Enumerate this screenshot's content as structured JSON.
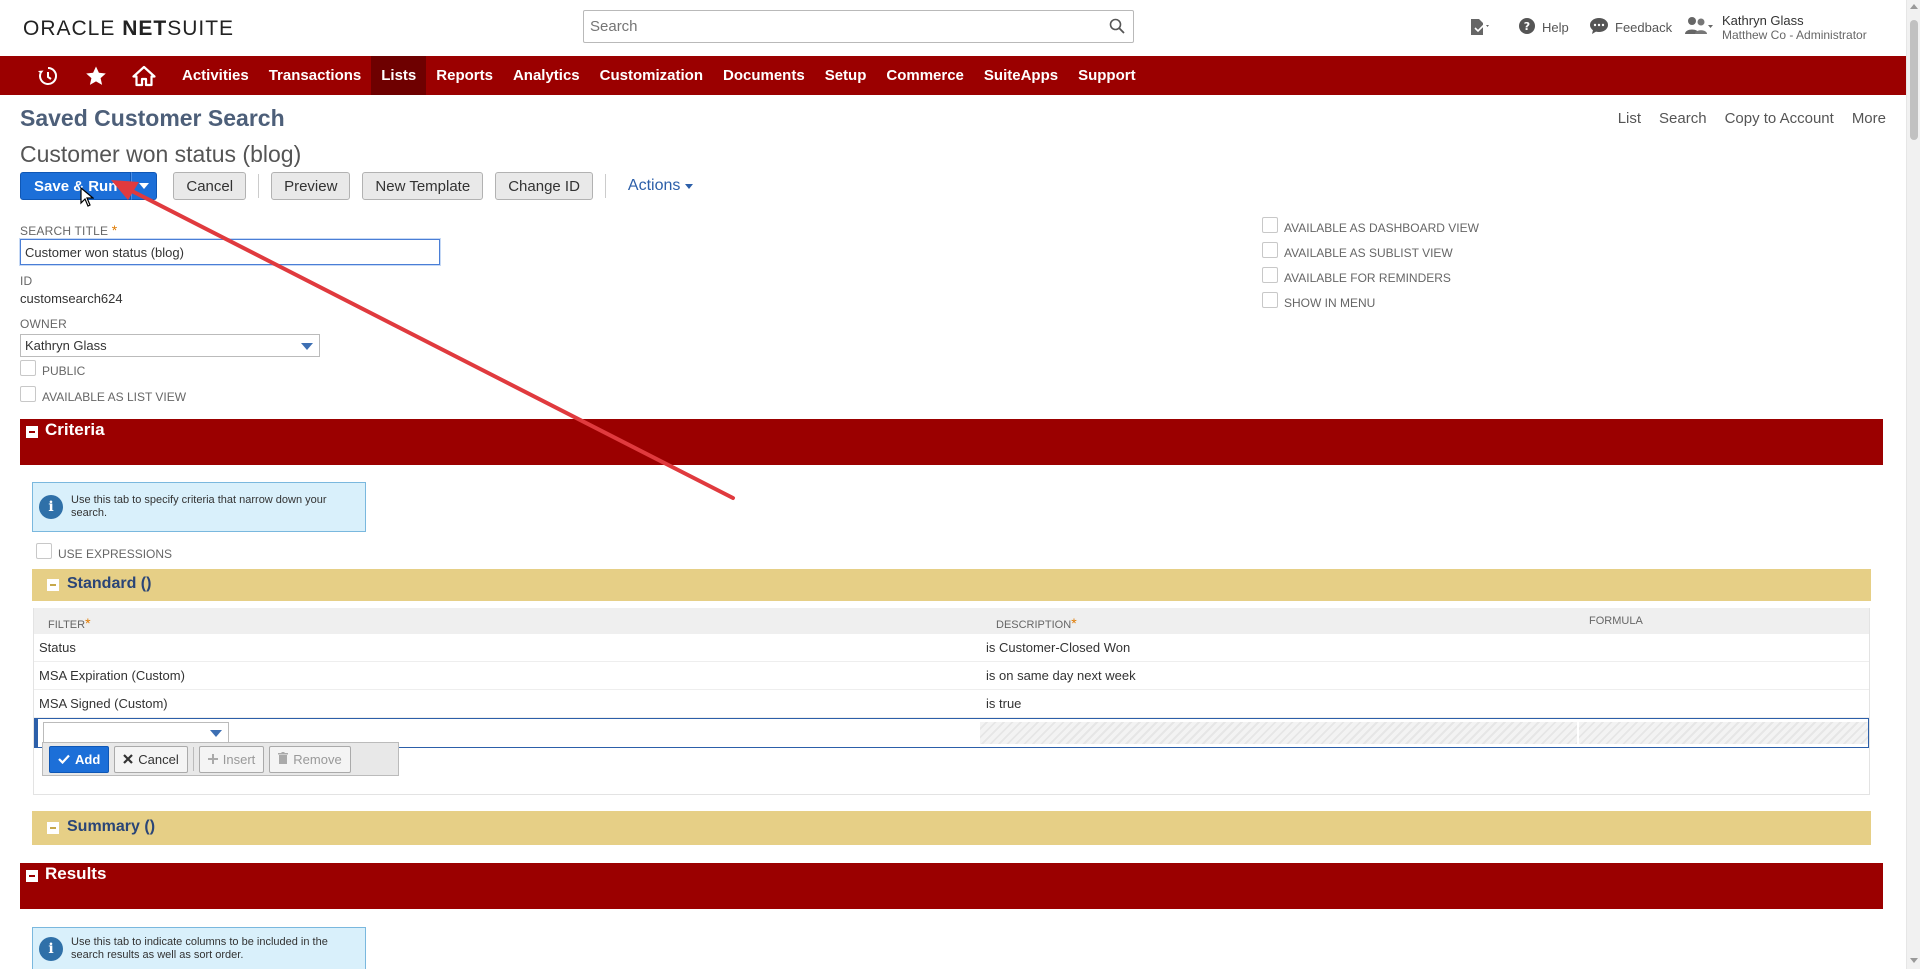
{
  "header": {
    "logo_brand": "ORACLE",
    "logo_product_bold": "NET",
    "logo_product": "SUITE",
    "search_placeholder": "Search",
    "help_label": "Help",
    "feedback_label": "Feedback",
    "user_name": "Kathryn Glass",
    "user_role": "Matthew Co - Administrator"
  },
  "nav": {
    "items": [
      "Activities",
      "Transactions",
      "Lists",
      "Reports",
      "Analytics",
      "Customization",
      "Documents",
      "Setup",
      "Commerce",
      "SuiteApps",
      "Support"
    ],
    "active": "Lists"
  },
  "page": {
    "header": "Saved Customer Search",
    "links": [
      "List",
      "Search",
      "Copy to Account",
      "More"
    ],
    "record_title": "Customer won status (blog)"
  },
  "toolbar": {
    "save_run": "Save & Run",
    "cancel": "Cancel",
    "preview": "Preview",
    "new_template": "New Template",
    "change_id": "Change ID",
    "actions": "Actions"
  },
  "form": {
    "search_title_label": "SEARCH TITLE",
    "search_title_value": "Customer won status (blog)",
    "id_label": "ID",
    "id_value": "customsearch624",
    "owner_label": "OWNER",
    "owner_value": "Kathryn Glass",
    "public_label": "PUBLIC",
    "list_view_label": "AVAILABLE AS LIST VIEW",
    "dashboard_label": "AVAILABLE AS DASHBOARD VIEW",
    "sublist_label": "AVAILABLE AS SUBLIST VIEW",
    "reminders_label": "AVAILABLE FOR REMINDERS",
    "menu_label": "SHOW IN MENU"
  },
  "criteria": {
    "title": "Criteria",
    "info": "Use this tab to specify criteria that narrow down your search.",
    "use_expressions": "USE EXPRESSIONS",
    "standard_title": "Standard ()",
    "columns": {
      "filter": "FILTER",
      "description": "DESCRIPTION",
      "formula": "FORMULA"
    },
    "rows": [
      {
        "filter": "Status",
        "description": "is Customer-Closed Won"
      },
      {
        "filter": "MSA Expiration (Custom)",
        "description": "is on same day next week"
      },
      {
        "filter": "MSA Signed (Custom)",
        "description": "is true"
      }
    ],
    "buttons": {
      "add": "Add",
      "cancel": "Cancel",
      "insert": "Insert",
      "remove": "Remove"
    },
    "summary_title": "Summary ()"
  },
  "results": {
    "title": "Results",
    "info": "Use this tab to indicate columns to be included in the search results as well as sort order."
  },
  "colors": {
    "brand_red": "#9b0000",
    "primary_blue": "#1c6fd8",
    "subtab_gold": "#e6cf86",
    "annotation_arrow": "#e03a3e"
  }
}
